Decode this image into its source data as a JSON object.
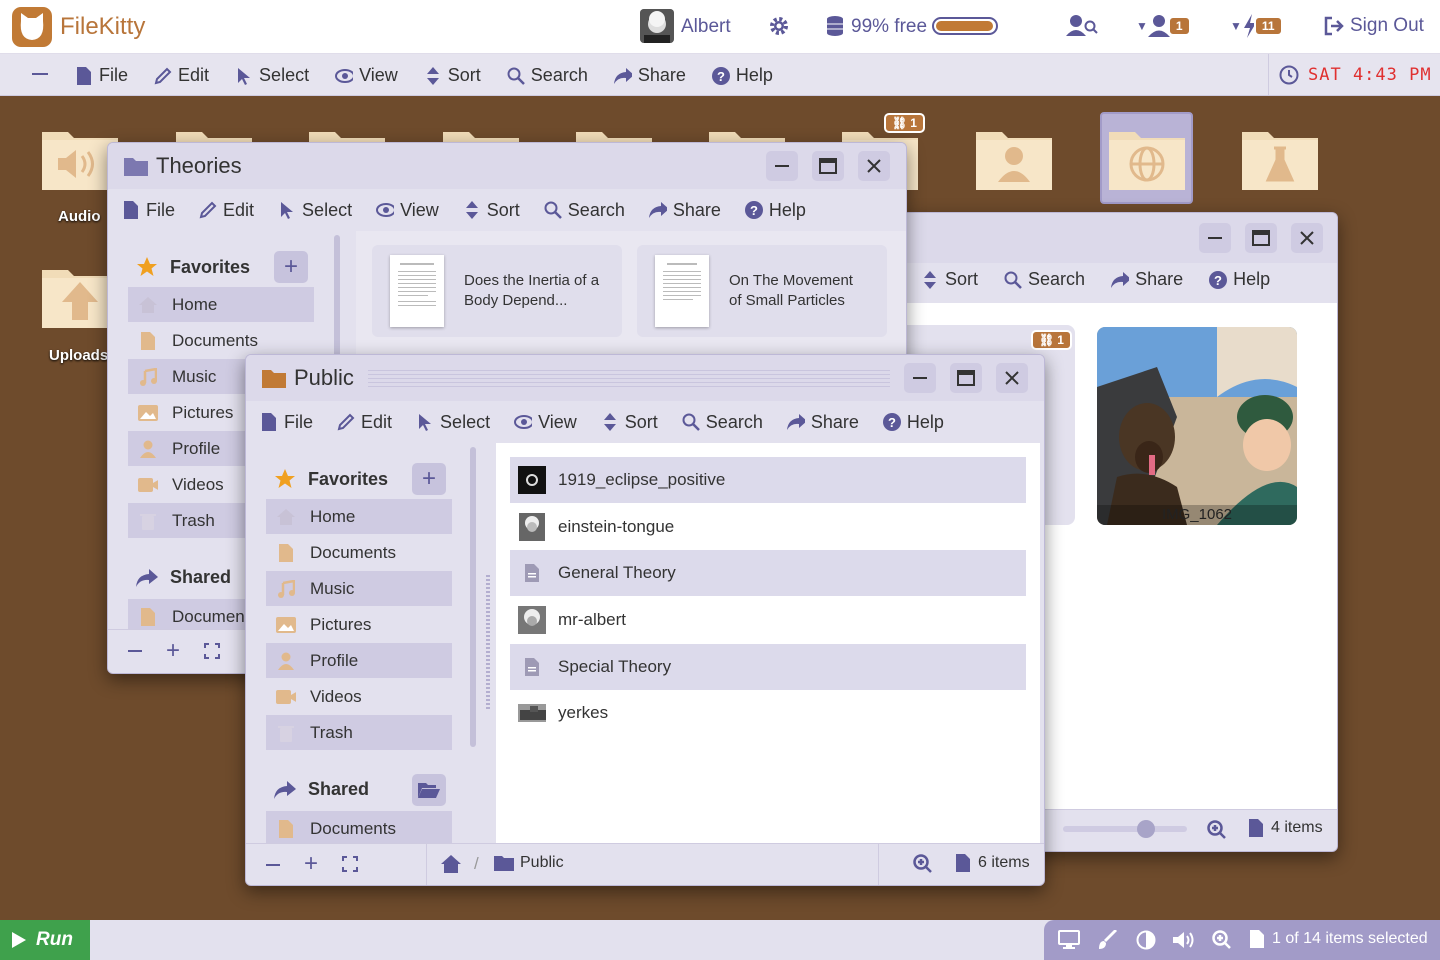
{
  "app": {
    "name": "FileKitty",
    "user": "Albert",
    "storage": "99% free",
    "storage_fill": 0.99,
    "signout": "Sign Out",
    "badge_shares": "1",
    "badge_notif": "11",
    "clock": "SAT 4:43 PM"
  },
  "menu": {
    "file": "File",
    "edit": "Edit",
    "select": "Select",
    "view": "View",
    "sort": "Sort",
    "search": "Search",
    "share": "Share",
    "help": "Help"
  },
  "desktop": {
    "audio": "Audio",
    "uploads": "Uploads",
    "link_badge": "1"
  },
  "theories": {
    "title": "Theories",
    "favorites": "Favorites",
    "shared": "Shared",
    "side": [
      "Home",
      "Documents",
      "Music",
      "Pictures",
      "Profile",
      "Videos",
      "Trash"
    ],
    "shared_items": [
      "Documents"
    ],
    "cards": [
      "Does the Inertia of a Body Depend...",
      "On The Movement of Small Particles"
    ]
  },
  "pictures": {
    "link_badge": "1",
    "photo_label": "IMG_1062",
    "items": "4 items",
    "zoom": 0.6
  },
  "public": {
    "title": "Public",
    "favorites": "Favorites",
    "shared": "Shared",
    "side": [
      "Home",
      "Documents",
      "Music",
      "Pictures",
      "Profile",
      "Videos",
      "Trash"
    ],
    "shared_items": [
      "Documents"
    ],
    "files": [
      "1919_eclipse_positive",
      "einstein-tongue",
      "General Theory",
      "mr-albert",
      "Special Theory",
      "yerkes"
    ],
    "breadcrumb": "Public",
    "items": "6 items"
  },
  "bottom": {
    "run": "Run",
    "selection": "1 of 14 items selected"
  },
  "colors": {
    "accent": "#5b5898",
    "brand": "#b8753a",
    "desktop": "#6e4b2c",
    "clock": "#e03030"
  }
}
